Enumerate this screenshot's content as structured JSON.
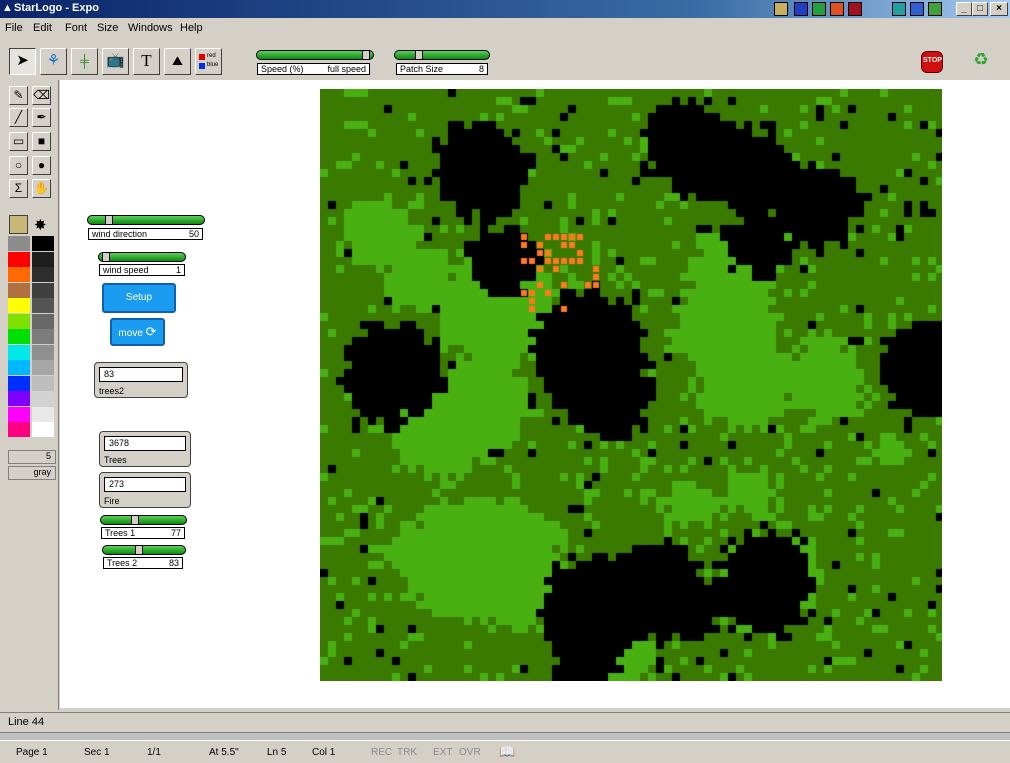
{
  "window": {
    "title": "StarLogo - Expo"
  },
  "menu": [
    "File",
    "Edit",
    "Font",
    "Size",
    "Windows",
    "Help"
  ],
  "toolbar": {
    "tools": [
      "pointer-tool",
      "turtle-tool",
      "slider-tool",
      "monitor-tool",
      "text-tool",
      "graph-tool",
      "color-tool"
    ],
    "text_glyph": "T",
    "color_tool_labels": [
      "red",
      "blue"
    ],
    "speed": {
      "label": "Speed (%)",
      "value": "full speed",
      "level": 1.0
    },
    "patch_size": {
      "label": "Patch Size",
      "value": "8"
    }
  },
  "stop_label": "STOP",
  "palette": {
    "colors_left": [
      "#8c8c8c",
      "#ff0000",
      "#ff6a00",
      "#b07040",
      "#ffff00",
      "#80e000",
      "#00e000",
      "#00e8e8",
      "#00b8ff",
      "#0030ff",
      "#8000ff",
      "#ff00ff",
      "#ff0080"
    ],
    "colors_right": [
      "#000000",
      "#1e1e1e",
      "#2e2e2e",
      "#404040",
      "#545454",
      "#686868",
      "#7c7c7c",
      "#909090",
      "#a6a6a6",
      "#bdbdbd",
      "#d2d2d2",
      "#e8e8e8",
      "#ffffff"
    ],
    "number": "5",
    "color_name": "gray"
  },
  "sliders": {
    "wind_direction": {
      "label": "wind direction",
      "value": "50",
      "level": 0.2
    },
    "wind_speed": {
      "label": "wind speed",
      "value": "1",
      "level": 0.05
    },
    "trees1": {
      "label": "Trees 1",
      "value": "77",
      "level": 0.42
    },
    "trees2": {
      "label": "Trees 2",
      "value": "83",
      "level": 0.45
    }
  },
  "buttons": {
    "setup": "Setup",
    "move": "move"
  },
  "monitors": {
    "trees2": {
      "value": "83",
      "label": "trees2"
    },
    "trees": {
      "value": "3678",
      "label": "Trees"
    },
    "fire": {
      "value": "273",
      "label": "Fire"
    }
  },
  "colors": {
    "forest_dark": "#3a7a00",
    "forest_light": "#48b010",
    "burnt": "#000000",
    "fire": "#ff7a1a"
  },
  "line_info": "Line 44",
  "status": {
    "page": "Page 1",
    "sec": "Sec 1",
    "pages": "1/1",
    "at": "At 5.5\"",
    "ln": "Ln 5",
    "col": "Col 1",
    "rec": "REC",
    "trk": "TRK",
    "ext": "EXT",
    "ovr": "OVR"
  }
}
